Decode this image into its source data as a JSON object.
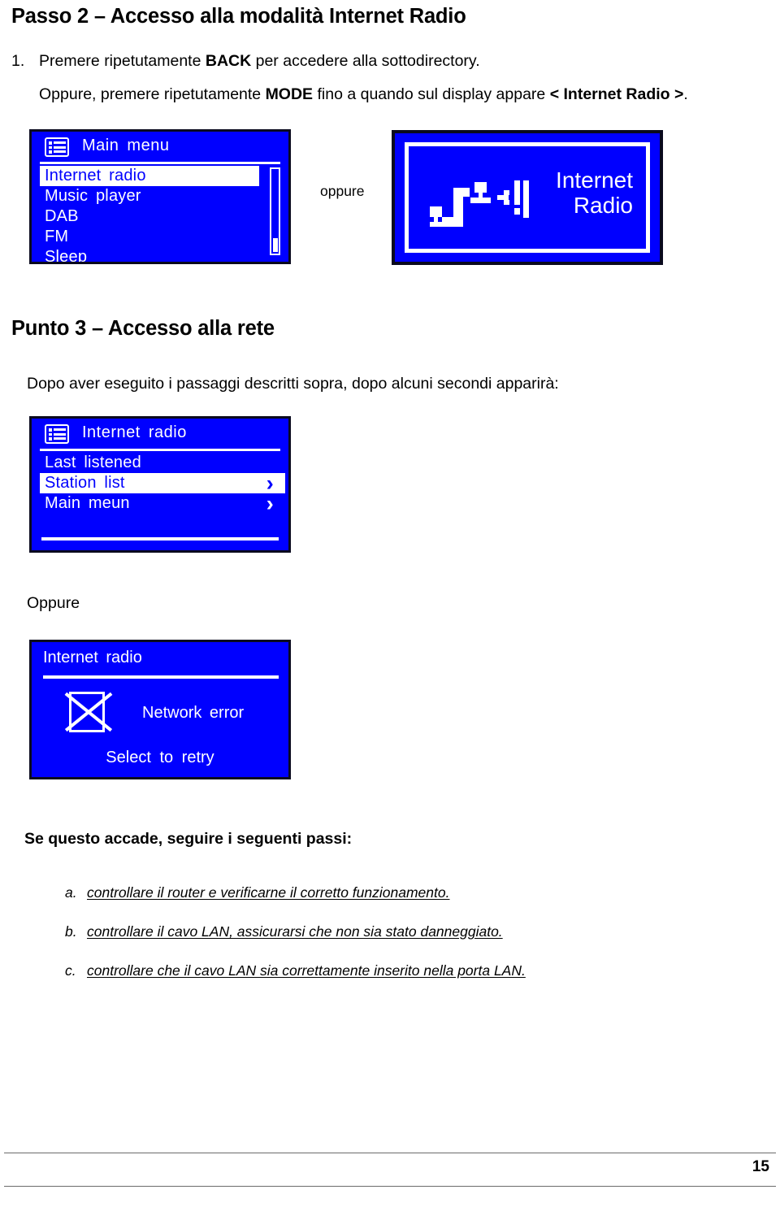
{
  "document": {
    "heading_step2": "Passo 2 – Accesso alla modalità Internet Radio",
    "step1_number": "1.",
    "step1_pre": "Premere ripetutamente ",
    "step1_bold": "BACK",
    "step1_post": " per accedere alla sottodirectory.",
    "step1_alt_pre": "Oppure, premere ripetutamente ",
    "step1_alt_bold": "MODE",
    "step1_alt_mid": " fino a quando sul display appare ",
    "step1_alt_bold2": "< Internet Radio >",
    "step1_alt_post": ".",
    "oppure_between_screens": "oppure",
    "heading_step3": "Punto 3 – Accesso alla rete",
    "para_step3": "Dopo aver eseguito i passaggi descritti sopra, dopo alcuni secondi apparirà:",
    "oppure_label": "Oppure",
    "troubleshoot_heading": "Se questo accade, seguire i seguenti passi:",
    "troubleshoot_items": [
      {
        "marker": "a.",
        "text": "controllare il router e verificarne il corretto funzionamento."
      },
      {
        "marker": "b.",
        "text": "controllare il cavo LAN, assicurarsi che non sia stato danneggiato."
      },
      {
        "marker": "c.",
        "text": "controllare che il cavo LAN sia correttamente inserito nella porta LAN."
      }
    ],
    "page_number": "15"
  },
  "colors": {
    "lcd_background": "#0000FF",
    "lcd_foreground": "#FFFFFF",
    "lcd_bezel": "#0A0A1E",
    "footer_rule": "#6B6B6B"
  },
  "screens": {
    "main_menu": {
      "title": "Main  menu",
      "icon": "list-icon",
      "items": [
        {
          "label": "Internet  radio",
          "selected": true
        },
        {
          "label": "Music  player",
          "selected": false
        },
        {
          "label": "DAB",
          "selected": false
        },
        {
          "label": "FM",
          "selected": false
        },
        {
          "label": "Sleep",
          "selected": false
        }
      ],
      "scrollbar": true
    },
    "splash": {
      "line1": "Internet",
      "line2": "Radio",
      "icon": "network-pixel-icon"
    },
    "internet_radio_menu": {
      "title": "Internet  radio",
      "icon": "list-icon",
      "items": [
        {
          "label": "Last  listened",
          "selected": false,
          "chevron": ""
        },
        {
          "label": "Station  list",
          "selected": true,
          "chevron": "›"
        },
        {
          "label": "Main  meun",
          "selected": false,
          "chevron": "›"
        }
      ]
    },
    "network_error": {
      "title": "Internet  radio",
      "icon": "crossed-box-icon",
      "message": "Network  error",
      "action": "Select  to  retry"
    }
  }
}
